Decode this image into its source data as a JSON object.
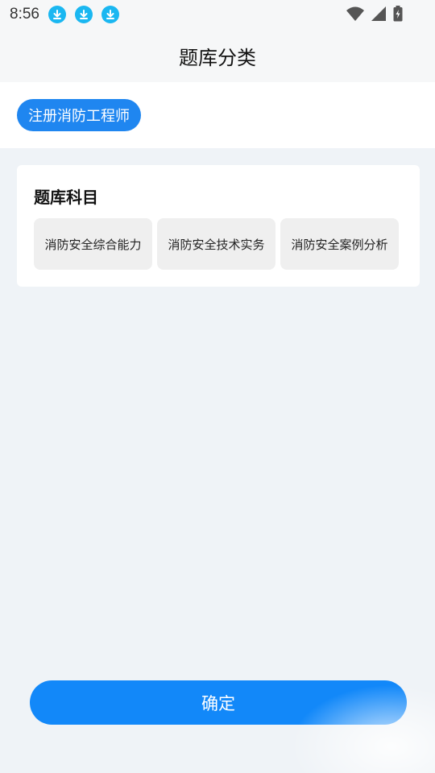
{
  "status_bar": {
    "time": "8:56",
    "notification_icons": [
      "download-icon",
      "download-icon",
      "download-icon"
    ],
    "right_icons": [
      "wifi-icon",
      "signal-icon",
      "battery-charging-icon"
    ]
  },
  "header": {
    "title": "题库分类"
  },
  "category_chips": [
    {
      "label": "注册消防工程师",
      "selected": true
    }
  ],
  "subject_card": {
    "title": "题库科目",
    "subjects": [
      {
        "label": "消防安全综合能力"
      },
      {
        "label": "消防安全技术实务"
      },
      {
        "label": "消防安全案例分析"
      }
    ]
  },
  "footer": {
    "confirm_label": "确定"
  },
  "colors": {
    "accent": "#1288f9",
    "chip_selected": "#1f86f0",
    "download_icon": "#1ab7f1",
    "page_background": "#eff3f7"
  }
}
